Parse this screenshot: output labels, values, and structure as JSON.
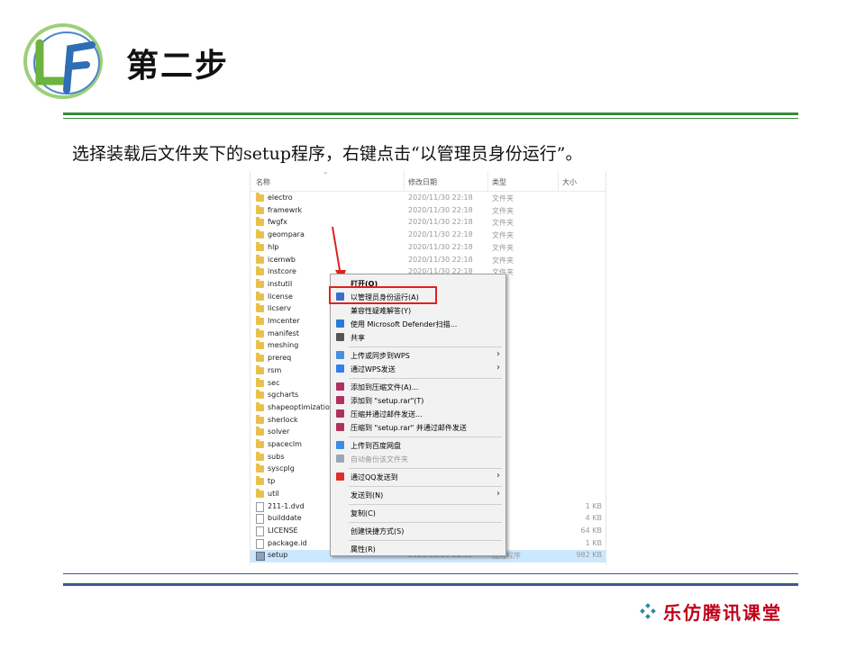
{
  "header": {
    "title": "第二步",
    "instruction": "选择装载后文件夹下的setup程序，右键点击“以管理员身份运行”。"
  },
  "explorer": {
    "columns": {
      "name": "名称",
      "date": "修改日期",
      "type": "类型",
      "size": "大小"
    },
    "rows": [
      {
        "name": "electro",
        "date": "2020/11/30 22:18",
        "type": "文件夹",
        "size": "",
        "kind": "folder"
      },
      {
        "name": "framewrk",
        "date": "2020/11/30 22:18",
        "type": "文件夹",
        "size": "",
        "kind": "folder"
      },
      {
        "name": "fwgfx",
        "date": "2020/11/30 22:18",
        "type": "文件夹",
        "size": "",
        "kind": "folder"
      },
      {
        "name": "geompara",
        "date": "2020/11/30 22:18",
        "type": "文件夹",
        "size": "",
        "kind": "folder"
      },
      {
        "name": "hlp",
        "date": "2020/11/30 22:18",
        "type": "文件夹",
        "size": "",
        "kind": "folder"
      },
      {
        "name": "icemwb",
        "date": "2020/11/30 22:18",
        "type": "文件夹",
        "size": "",
        "kind": "folder"
      },
      {
        "name": "instcore",
        "date": "2020/11/30 22:18",
        "type": "文件夹",
        "size": "",
        "kind": "folder"
      },
      {
        "name": "instutil",
        "date": "",
        "type": "夹",
        "size": "",
        "kind": "folder"
      },
      {
        "name": "license",
        "date": "",
        "type": "夹",
        "size": "",
        "kind": "folder"
      },
      {
        "name": "licserv",
        "date": "",
        "type": "夹",
        "size": "",
        "kind": "folder"
      },
      {
        "name": "lmcenter",
        "date": "",
        "type": "夹",
        "size": "",
        "kind": "folder"
      },
      {
        "name": "manifest",
        "date": "",
        "type": "夹",
        "size": "",
        "kind": "folder"
      },
      {
        "name": "meshing",
        "date": "",
        "type": "夹",
        "size": "",
        "kind": "folder"
      },
      {
        "name": "prereq",
        "date": "",
        "type": "夹",
        "size": "",
        "kind": "folder"
      },
      {
        "name": "rsm",
        "date": "",
        "type": "夹",
        "size": "",
        "kind": "folder"
      },
      {
        "name": "sec",
        "date": "",
        "type": "夹",
        "size": "",
        "kind": "folder"
      },
      {
        "name": "sgcharts",
        "date": "",
        "type": "夹",
        "size": "",
        "kind": "folder"
      },
      {
        "name": "shapeoptimization",
        "date": "",
        "type": "夹",
        "size": "",
        "kind": "folder"
      },
      {
        "name": "sherlock",
        "date": "",
        "type": "夹",
        "size": "",
        "kind": "folder"
      },
      {
        "name": "solver",
        "date": "",
        "type": "夹",
        "size": "",
        "kind": "folder"
      },
      {
        "name": "spaceclm",
        "date": "",
        "type": "夹",
        "size": "",
        "kind": "folder"
      },
      {
        "name": "subs",
        "date": "",
        "type": "夹",
        "size": "",
        "kind": "folder"
      },
      {
        "name": "syscplg",
        "date": "",
        "type": "夹",
        "size": "",
        "kind": "folder"
      },
      {
        "name": "tp",
        "date": "",
        "type": "夹",
        "size": "",
        "kind": "folder"
      },
      {
        "name": "util",
        "date": "",
        "type": "夹",
        "size": "",
        "kind": "folder"
      },
      {
        "name": "211-1.dvd",
        "date": "",
        "type": "文件",
        "size": "1 KB",
        "kind": "file"
      },
      {
        "name": "builddate",
        "date": "",
        "type": "文档",
        "size": "4 KB",
        "kind": "file"
      },
      {
        "name": "LICENSE",
        "date": "",
        "type": "文档",
        "size": "64 KB",
        "kind": "file"
      },
      {
        "name": "package.id",
        "date": "",
        "type": "件",
        "size": "1 KB",
        "kind": "file"
      },
      {
        "name": "setup",
        "date": "2020/11/30 22:19",
        "type": "应用程序",
        "size": "982 KB",
        "kind": "exe",
        "selected": true
      }
    ]
  },
  "context_menu": {
    "items": [
      {
        "label": "打开(O)",
        "bold": true,
        "icon": "",
        "sub": false
      },
      {
        "label": "以管理员身份运行(A)",
        "icon": "shield-icon",
        "iconColor": "#3a6fc9",
        "sub": false
      },
      {
        "label": "兼容性疑难解答(Y)",
        "icon": "",
        "sub": false
      },
      {
        "label": "使用 Microsoft Defender扫描...",
        "icon": "defender-icon",
        "iconColor": "#2a7ad5",
        "sub": false
      },
      {
        "label": "共享",
        "icon": "share-icon",
        "iconColor": "#555555",
        "sub": false
      },
      {
        "sep": true
      },
      {
        "label": "上传或同步到WPS",
        "icon": "cloud-icon",
        "iconColor": "#4a8ee0",
        "sub": true
      },
      {
        "label": "通过WPS发送",
        "icon": "send-icon",
        "iconColor": "#2f80ed",
        "sub": true
      },
      {
        "sep": true
      },
      {
        "label": "添加到压缩文件(A)...",
        "icon": "winrar-icon",
        "iconColor": "#b03060",
        "sub": false
      },
      {
        "label": "添加到 \"setup.rar\"(T)",
        "icon": "winrar-icon",
        "iconColor": "#b03060",
        "sub": false
      },
      {
        "label": "压缩并通过邮件发送...",
        "icon": "winrar-icon",
        "iconColor": "#b03060",
        "sub": false
      },
      {
        "label": "压缩到 \"setup.rar\" 并通过邮件发送",
        "icon": "winrar-icon",
        "iconColor": "#b03060",
        "sub": false
      },
      {
        "sep": true
      },
      {
        "label": "上传到百度网盘",
        "icon": "baidu-icon",
        "iconColor": "#3a8ee6",
        "sub": false
      },
      {
        "label": "自动备份该文件夹",
        "icon": "backup-icon",
        "iconColor": "#9aa7b8",
        "dim": true,
        "sub": false
      },
      {
        "sep": true
      },
      {
        "label": "通过QQ发送到",
        "icon": "qq-icon",
        "iconColor": "#d9302c",
        "sub": true
      },
      {
        "sep": true
      },
      {
        "label": "发送到(N)",
        "icon": "",
        "sub": true
      },
      {
        "sep": true
      },
      {
        "label": "复制(C)",
        "icon": "",
        "sub": false
      },
      {
        "sep": true
      },
      {
        "label": "创建快捷方式(S)",
        "icon": "",
        "sub": false
      },
      {
        "sep": true
      },
      {
        "label": "属性(R)",
        "icon": "",
        "sub": false
      }
    ]
  },
  "brand": {
    "text": "乐仿腾讯课堂"
  },
  "colors": {
    "accent_green": "#3a8a3a",
    "accent_blue": "#3a5a8a",
    "highlight_red": "#e02020",
    "brand_red": "#c0001a"
  }
}
